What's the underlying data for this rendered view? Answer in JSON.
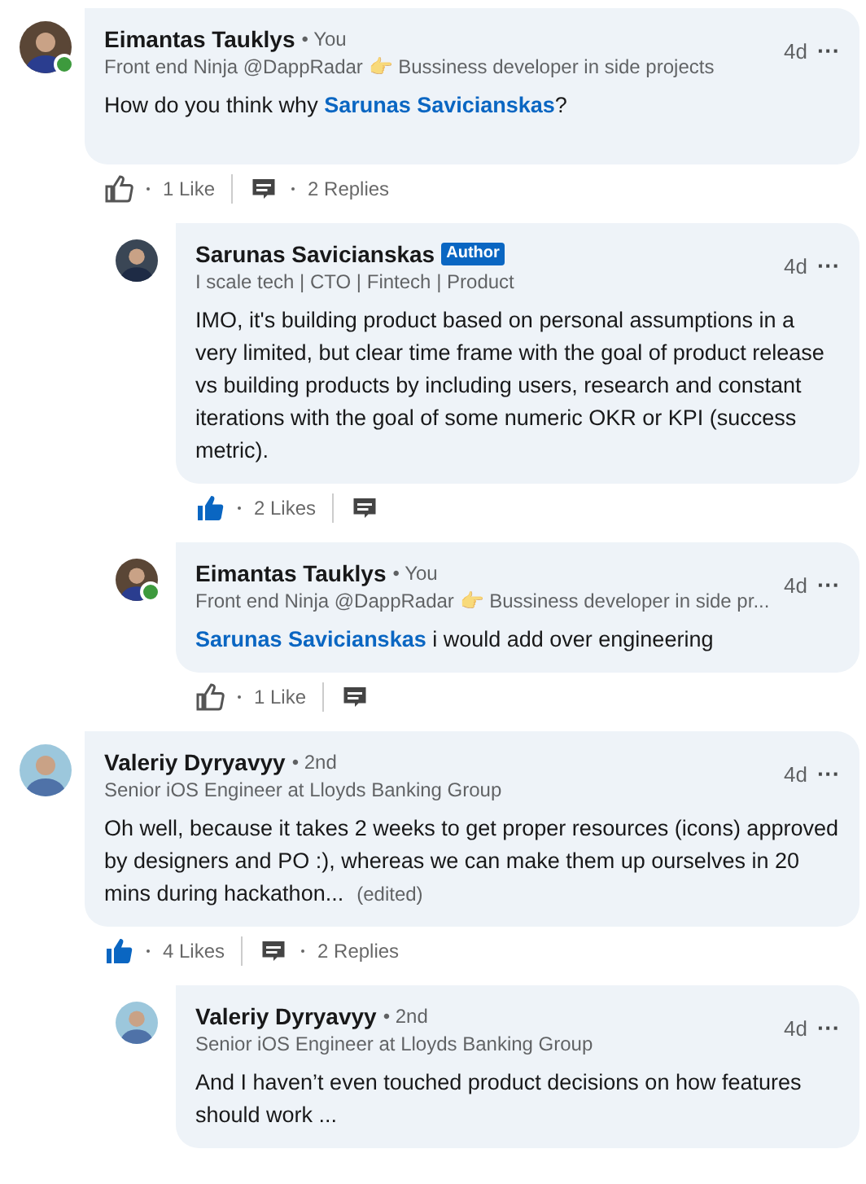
{
  "comments": [
    {
      "author": "Eimantas Tauklys",
      "degree": "• You",
      "online": true,
      "headline": "Front end Ninja @DappRadar 👉 Bussiness developer in side projects",
      "time": "4d",
      "more": "···",
      "body": [
        {
          "kind": "text",
          "text": "How do you think why "
        },
        {
          "kind": "mention",
          "text": "Sarunas Savicianskas"
        },
        {
          "kind": "text",
          "text": "?"
        }
      ],
      "liked": false,
      "likes": "1 Like",
      "replies_label": "2 Replies",
      "children": [
        {
          "author": "Sarunas Savicianskas",
          "badge": "Author",
          "online": false,
          "headline": "I scale tech | CTO | Fintech | Product",
          "time": "4d",
          "more": "···",
          "body": [
            {
              "kind": "text",
              "text": "IMO, it's building product based on personal assumptions in a very limited, but clear time frame with the goal of product release vs building products by including users, research and constant iterations with the goal of some numeric OKR or KPI (success metric)."
            }
          ],
          "liked": true,
          "likes": "2 Likes"
        },
        {
          "author": "Eimantas Tauklys",
          "degree": "• You",
          "online": true,
          "headline": "Front end Ninja @DappRadar 👉 Bussiness developer in side pr...",
          "time": "4d",
          "more": "···",
          "body": [
            {
              "kind": "mention",
              "text": "Sarunas Savicianskas"
            },
            {
              "kind": "text",
              "text": " i would add over engineering"
            }
          ],
          "liked": false,
          "likes": "1 Like"
        }
      ]
    },
    {
      "author": "Valeriy Dyryavyy",
      "degree": "• 2nd",
      "online": false,
      "headline": "Senior iOS Engineer at Lloyds Banking Group",
      "time": "4d",
      "more": "···",
      "body": [
        {
          "kind": "text",
          "text": "Oh well, because it takes 2 weeks to get proper resources (icons) approved by designers and PO :), whereas we can make them up ourselves in 20 mins during hackathon..."
        }
      ],
      "edited": "(edited)",
      "liked": true,
      "likes": "4 Likes",
      "replies_label": "2 Replies",
      "children": [
        {
          "author": "Valeriy Dyryavyy",
          "degree": "• 2nd",
          "online": false,
          "headline": "Senior iOS Engineer at Lloyds Banking Group",
          "time": "4d",
          "more": "···",
          "body": [
            {
              "kind": "text",
              "text": "And I haven’t even touched product decisions on how features should work ..."
            }
          ]
        }
      ]
    }
  ]
}
